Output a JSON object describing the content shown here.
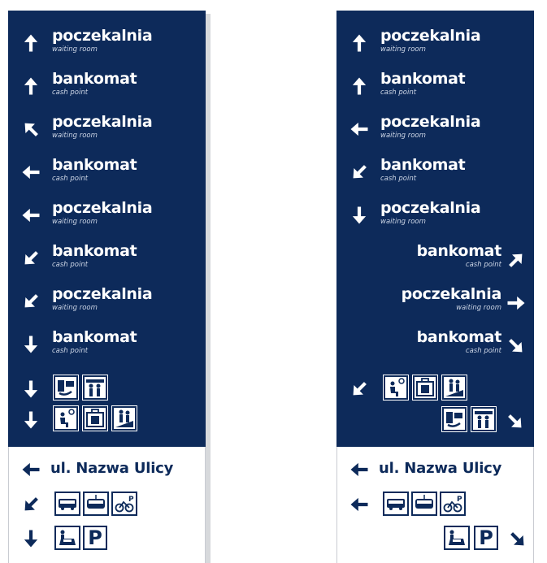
{
  "colors": {
    "navy": "#0d2a5a",
    "white": "#ffffff"
  },
  "left": {
    "rows": [
      {
        "main": "poczekalnia",
        "sub": "waiting room",
        "arrow": "up"
      },
      {
        "main": "bankomat",
        "sub": "cash point",
        "arrow": "up"
      },
      {
        "main": "poczekalnia",
        "sub": "waiting room",
        "arrow": "up-left"
      },
      {
        "main": "bankomat",
        "sub": "cash point",
        "arrow": "left"
      },
      {
        "main": "poczekalnia",
        "sub": "waiting room",
        "arrow": "left"
      },
      {
        "main": "bankomat",
        "sub": "cash point",
        "arrow": "down-left"
      },
      {
        "main": "poczekalnia",
        "sub": "waiting room",
        "arrow": "down-left"
      },
      {
        "main": "bankomat",
        "sub": "cash point",
        "arrow": "down"
      }
    ],
    "street": "ul. Nazwa Ulicy",
    "parking": "P"
  },
  "right": {
    "rows": [
      {
        "main": "poczekalnia",
        "sub": "waiting room",
        "arrow": "up"
      },
      {
        "main": "bankomat",
        "sub": "cash point",
        "arrow": "up"
      },
      {
        "main": "poczekalnia",
        "sub": "waiting room",
        "arrow": "left"
      },
      {
        "main": "bankomat",
        "sub": "cash point",
        "arrow": "down-left"
      },
      {
        "main": "poczekalnia",
        "sub": "waiting room",
        "arrow": "down"
      },
      {
        "main": "bankomat",
        "sub": "cash point",
        "arrow": "up-right"
      },
      {
        "main": "poczekalnia",
        "sub": "waiting room",
        "arrow": "right"
      },
      {
        "main": "bankomat",
        "sub": "cash point",
        "arrow": "down-right"
      }
    ],
    "street": "ul. Nazwa Ulicy",
    "parking": "P"
  }
}
